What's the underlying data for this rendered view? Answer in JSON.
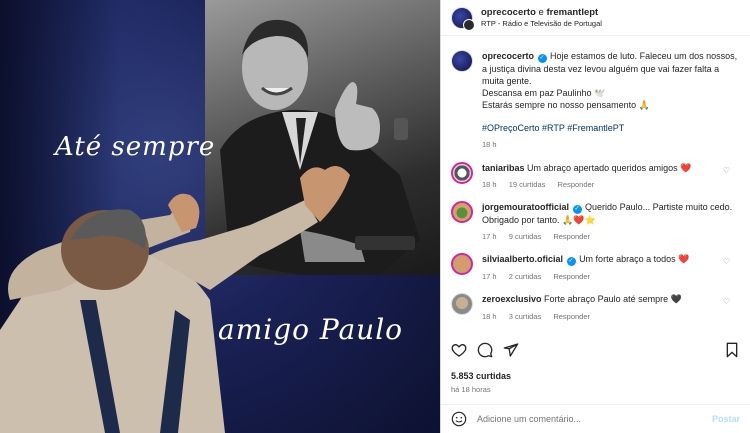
{
  "image": {
    "caption_top": "Até sempre",
    "caption_bottom": "amigo Paulo"
  },
  "header": {
    "user1": "oprecocerto",
    "separator": "e",
    "user2": "fremantlept",
    "subtitle": "RTP - Rádio e Televisão de Portugal"
  },
  "caption": {
    "user": "oprecocerto",
    "line1": "Hoje estamos de luto. Faleceu um dos nossos, a justiça divina desta vez levou alguém que vai fazer falta a muita gente.",
    "line2": "Descansa em paz Paulinho 🕊️",
    "line3": "Estarás sempre no nosso pensamento 🙏",
    "tags": "#OPreçoCerto #RTP #FremantlePT",
    "time": "18 h"
  },
  "comments": [
    {
      "user": "taniaribas",
      "verified": false,
      "text": "Um abraço apertado queridos amigos ❤️",
      "time": "18 h",
      "likes": "19 curtidas",
      "reply": "Responder"
    },
    {
      "user": "jorgemouratoofficial",
      "verified": true,
      "text": "Querido Paulo... Partiste muito cedo. Obrigado por tanto. 🙏❤️⭐",
      "time": "17 h",
      "likes": "9 curtidas",
      "reply": "Responder"
    },
    {
      "user": "silviaalberto.oficial",
      "verified": true,
      "text": "Um forte abraço a todos ❤️",
      "time": "17 h",
      "likes": "2 curtidas",
      "reply": "Responder"
    },
    {
      "user": "zeroexclusivo",
      "verified": false,
      "text": "Forte abraço Paulo até sempre 🖤",
      "time": "18 h",
      "likes": "3 curtidas",
      "reply": "Responder"
    }
  ],
  "stats": {
    "likes": "5.853 curtidas",
    "ago": "há 18 horas"
  },
  "add_comment": {
    "placeholder": "Adicione um comentário...",
    "post_label": "Postar"
  },
  "icons": {
    "like": "heart-icon",
    "comment": "comment-icon",
    "share": "share-icon",
    "save": "bookmark-icon",
    "emoji": "emoji-icon",
    "verified": "verified-badge-icon"
  },
  "colors": {
    "verified": "#0095f6",
    "link": "#00376b",
    "muted": "#737373",
    "post_disabled": "#b2dffc"
  }
}
